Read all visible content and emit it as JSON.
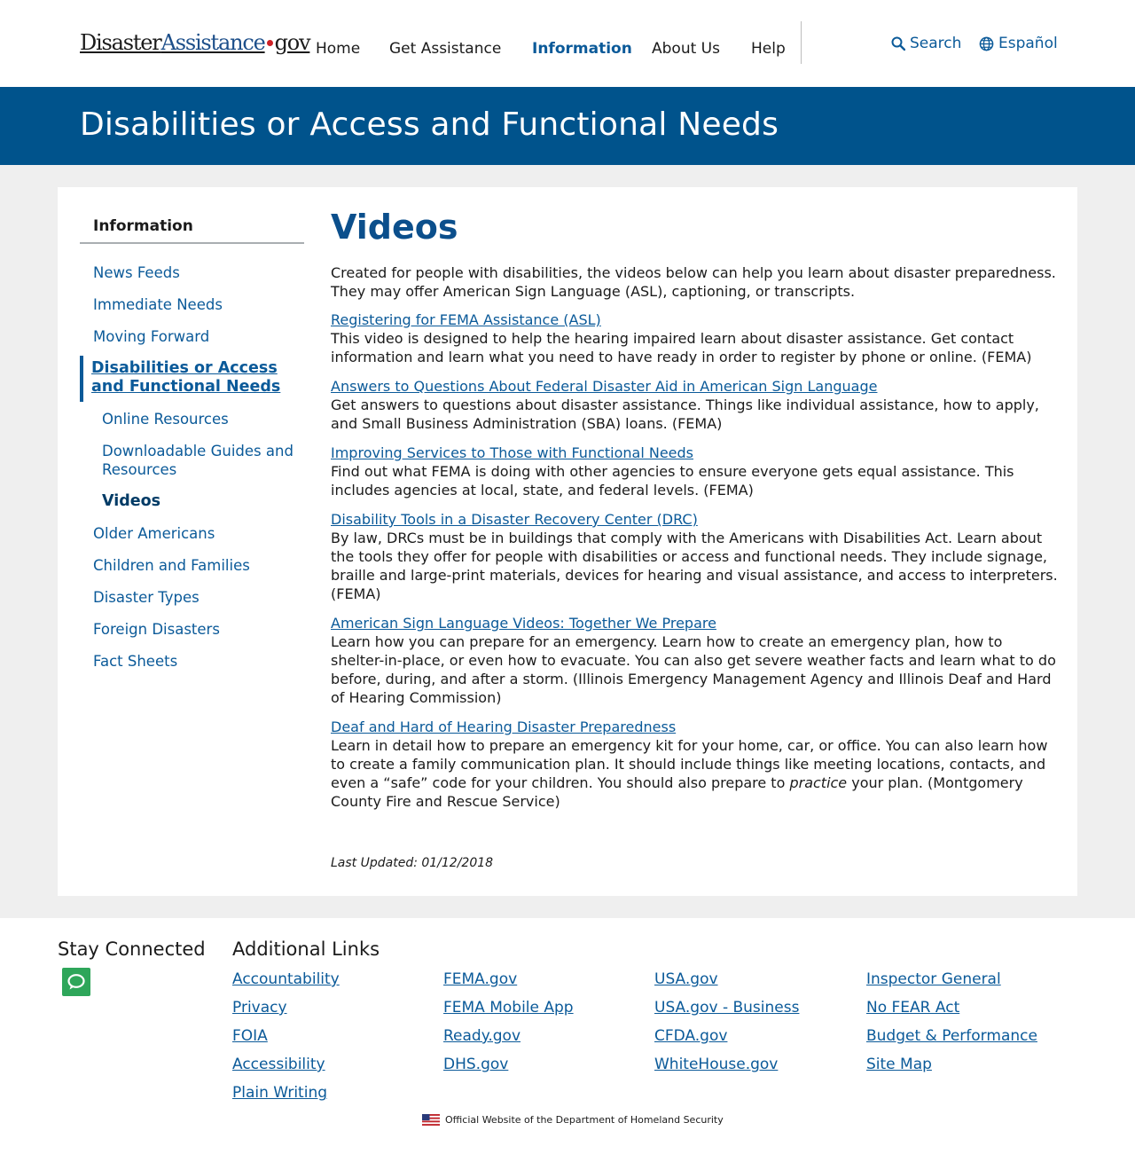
{
  "header": {
    "logo": {
      "part1": "Disaster",
      "part2": "Assistance",
      "part3": "gov"
    },
    "nav": [
      "Home",
      "Get Assistance",
      "Information",
      "About Us",
      "Help"
    ],
    "active_nav": "Information",
    "search_label": "Search",
    "language_label": "Español",
    "accent_color": "#0b5a99"
  },
  "hero": {
    "title": "Disabilities or Access and Functional Needs",
    "background_color": "#00538c"
  },
  "sidebar": {
    "title": "Information",
    "items_top": [
      "News Feeds",
      "Immediate Needs",
      "Moving Forward"
    ],
    "active_item": "Disabilities or Access and Functional Needs",
    "sub_items": [
      "Online Resources",
      "Downloadable Guides and Resources",
      "Videos"
    ],
    "current_sub_item": "Videos",
    "items_bottom": [
      "Older Americans",
      "Children and Families",
      "Disaster Types",
      "Foreign Disasters",
      "Fact Sheets"
    ]
  },
  "main": {
    "title": "Videos",
    "intro": "Created for people with disabilities, the videos below can help you learn about disaster preparedness. They may offer American Sign Language (ASL), captioning, or transcripts.",
    "videos": [
      {
        "title": "Registering for FEMA Assistance (ASL)",
        "description": "This video is designed to help the hearing impaired learn about disaster assistance. Get contact information and learn what you need to have ready in order to register by phone or online. (FEMA)"
      },
      {
        "title": "Answers to Questions About Federal Disaster Aid in American Sign Language",
        "description": "Get answers to questions about disaster assistance. Things like individual assistance, how to apply, and Small Business Administration (SBA) loans. (FEMA)"
      },
      {
        "title": "Improving Services to Those with Functional Needs",
        "description": "Find out what FEMA is doing with other agencies to ensure everyone gets equal assistance. This includes agencies at local, state, and federal levels. (FEMA)"
      },
      {
        "title": "Disability Tools in a Disaster Recovery Center (DRC)",
        "description": "By law, DRCs must be in buildings that comply with the Americans with Disabilities Act. Learn about the tools they offer for people with disabilities or access and functional needs. They include signage, braille and large-print materials, devices for hearing and visual assistance, and access to interpreters. (FEMA)"
      },
      {
        "title": "American Sign Language Videos: Together We Prepare",
        "description": "Learn how you can prepare for an emergency. Learn how to create an emergency plan, how to shelter-in-place, or even how to evacuate. You can also get severe weather facts and learn what to do before, during, and after a storm. (Illinois Emergency Management Agency and Illinois Deaf and Hard of Hearing Commission)"
      },
      {
        "title": "Deaf and Hard of Hearing Disaster Preparedness",
        "description_before": "Learn in detail how to prepare an emergency kit for your home, car, or office. You can also learn how to create a family communication plan. It should include things like meeting locations, contacts, and even a “safe” code for your children. You should also prepare to ",
        "description_emphasis": "practice",
        "description_after": " your plan. (Montgomery County Fire and Rescue Service)"
      }
    ],
    "last_updated": "Last Updated: 01/12/2018"
  },
  "footer": {
    "stay_connected": "Stay Connected",
    "chat_icon": "chat-bubble-icon",
    "additional_links_title": "Additional Links",
    "columns": [
      [
        "Accountability",
        "Privacy",
        "FOIA",
        "Accessibility",
        "Plain Writing"
      ],
      [
        "FEMA.gov",
        "FEMA Mobile App",
        "Ready.gov",
        "DHS.gov"
      ],
      [
        "USA.gov",
        "USA.gov - Business",
        "CFDA.gov",
        "WhiteHouse.gov"
      ],
      [
        "Inspector General",
        "No FEAR Act",
        "Budget & Performance",
        "Site Map"
      ]
    ],
    "official_text": "Official Website of the Department of Homeland Security",
    "flag_icon": "us-flag-icon"
  }
}
